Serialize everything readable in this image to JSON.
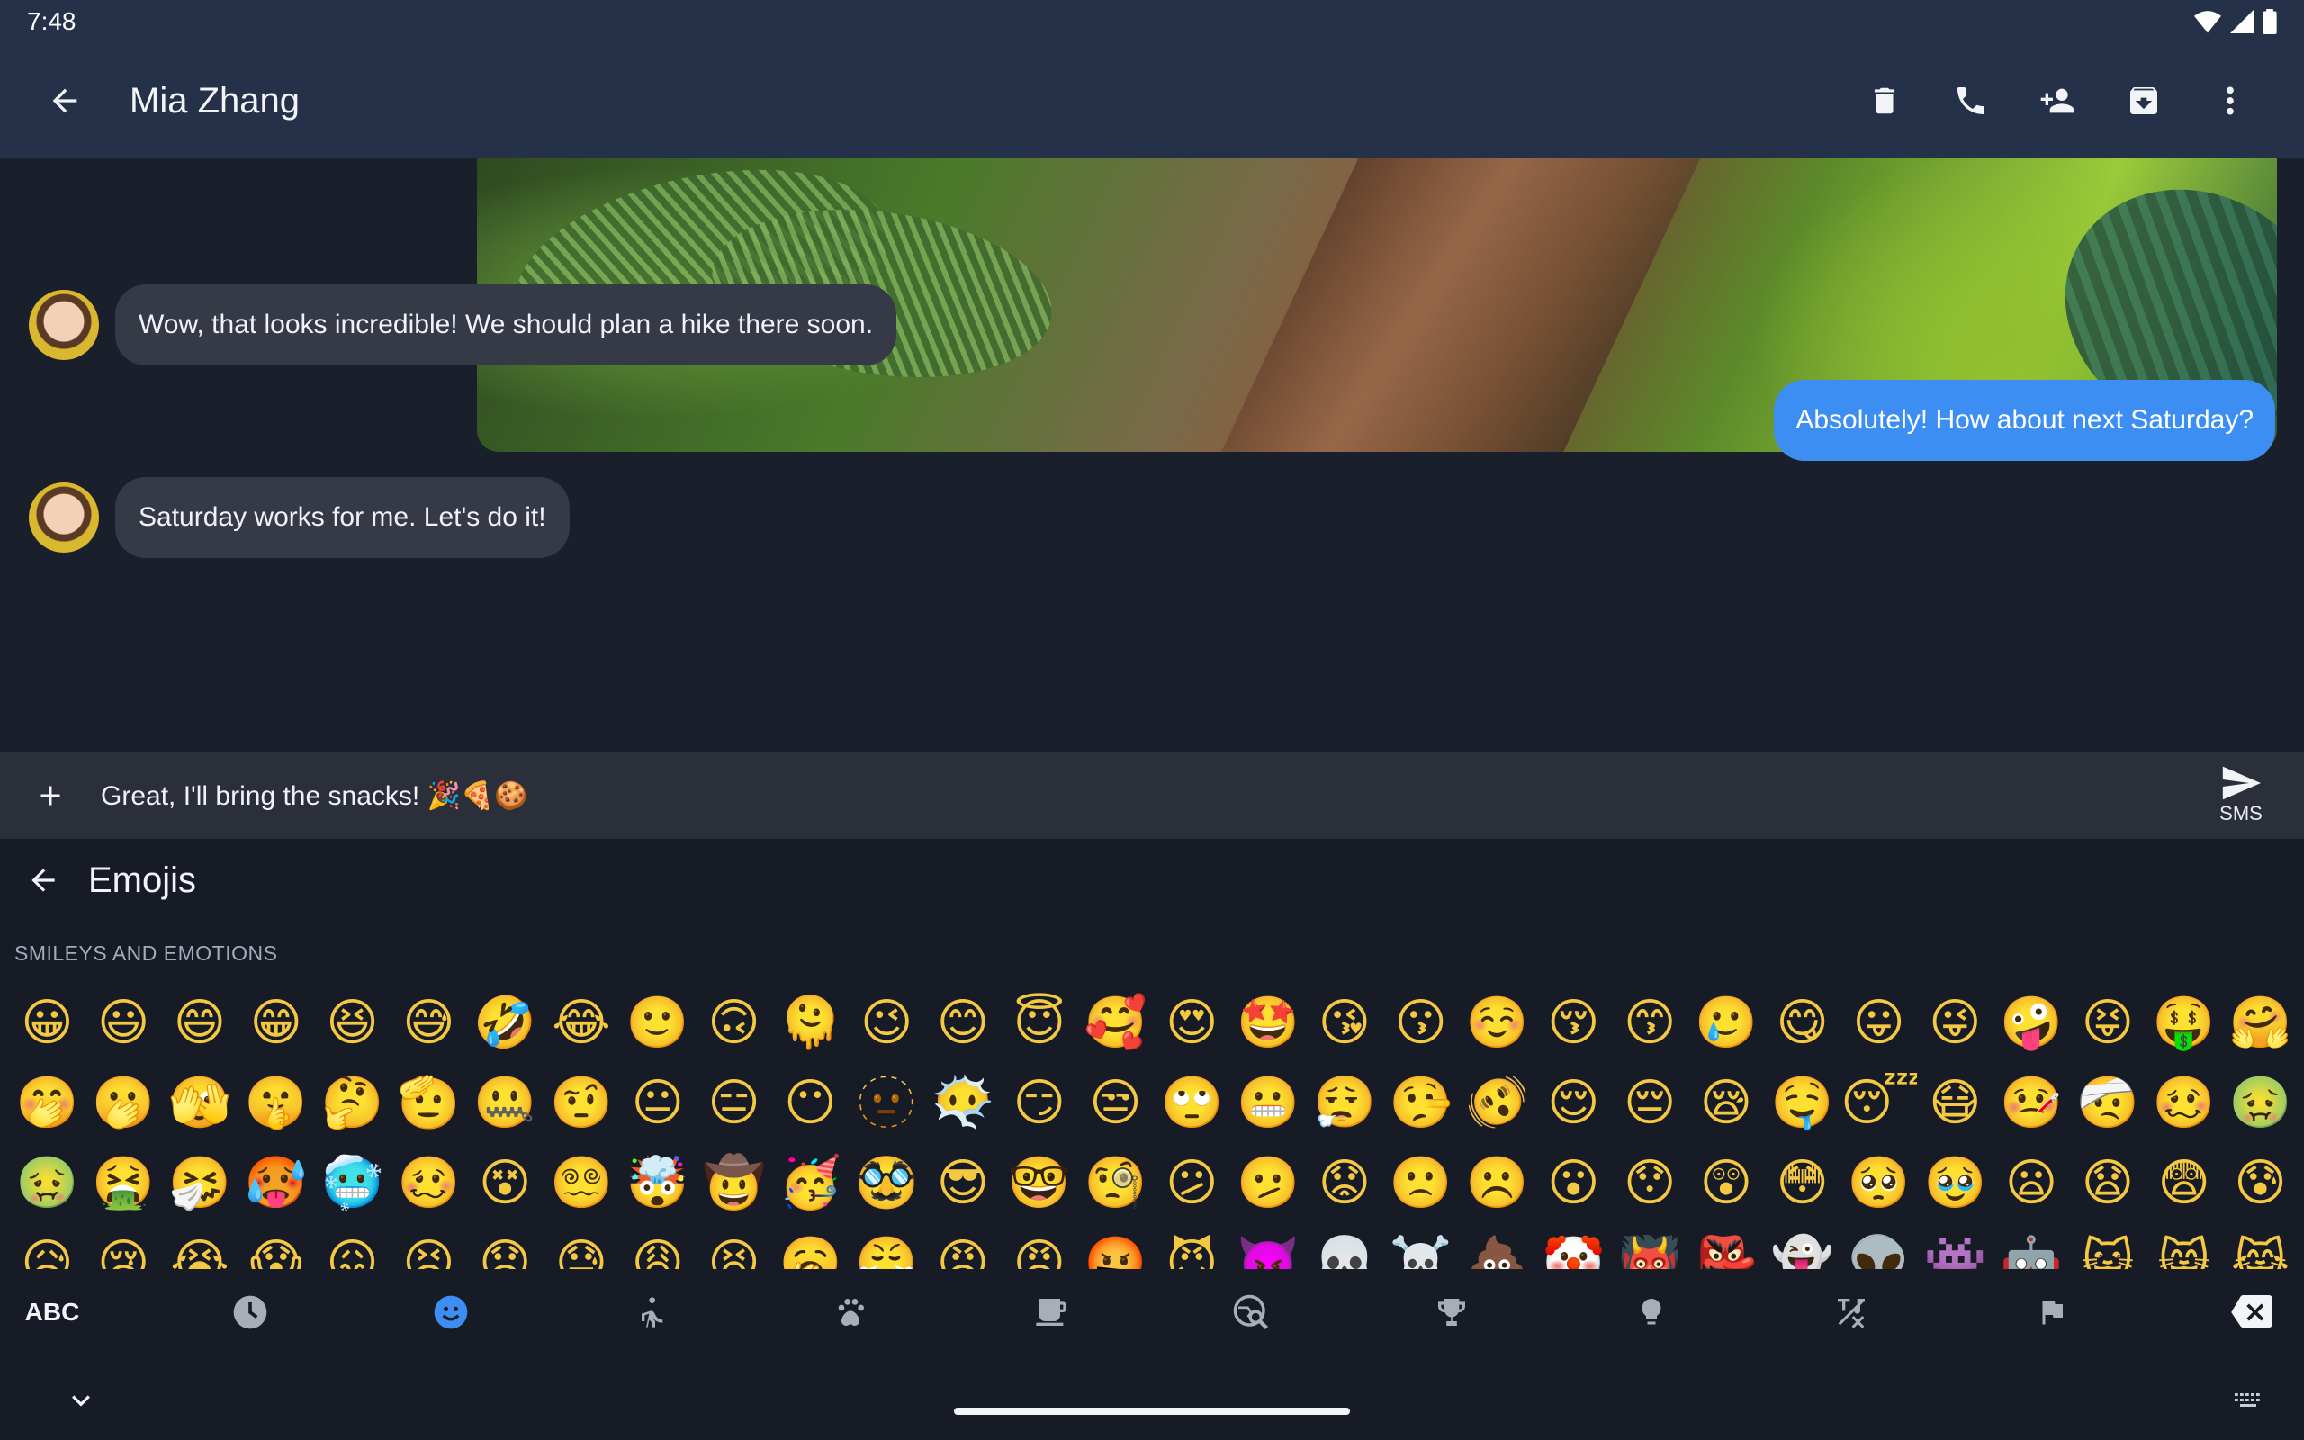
{
  "status": {
    "time": "7:48"
  },
  "header": {
    "contact_name": "Mia Zhang"
  },
  "messages": {
    "m1": "Wow, that looks incredible! We should plan a hike there soon.",
    "m2": "Absolutely! How about next Saturday?",
    "m3": "Saturday works for me. Let's do it!"
  },
  "compose": {
    "text": "Great, I'll bring the snacks! 🎉🍕🍪",
    "send_label": "SMS"
  },
  "emoji_picker": {
    "title": "Emojis",
    "category_label": "SMILEYS AND EMOTIONS",
    "rows": [
      [
        "😀",
        "😃",
        "😄",
        "😁",
        "😆",
        "😅",
        "🤣",
        "😂",
        "🙂",
        "🙃",
        "🫠",
        "😉",
        "😊",
        "😇",
        "🥰",
        "😍",
        "🤩",
        "😘",
        "😗",
        "☺️",
        "😚",
        "😙",
        "🥲",
        "😋",
        "😛",
        "😜",
        "🤪",
        "😝",
        "🤑",
        "🤗"
      ],
      [
        "🤭",
        "🫢",
        "🫣",
        "🤫",
        "🤔",
        "🫡",
        "🤐",
        "🤨",
        "😐",
        "😑",
        "😶",
        "🫥",
        "😶‍🌫️",
        "😏",
        "😒",
        "🙄",
        "😬",
        "😮‍💨",
        "🤥",
        "🫨",
        "😌",
        "😔",
        "😪",
        "🤤",
        "😴",
        "😷",
        "🤒",
        "🤕",
        "🥴",
        "🤢"
      ],
      [
        "🤢",
        "🤮",
        "🤧",
        "🥵",
        "🥶",
        "🥴",
        "😵",
        "😵‍💫",
        "🤯",
        "🤠",
        "🥳",
        "🥸",
        "😎",
        "🤓",
        "🧐",
        "😕",
        "🫤",
        "😟",
        "🙁",
        "☹️",
        "😮",
        "😯",
        "😲",
        "😳",
        "🥺",
        "🥹",
        "😦",
        "😧",
        "😨",
        "😰"
      ],
      [
        "😥",
        "😢",
        "😭",
        "😱",
        "😖",
        "😣",
        "😞",
        "😓",
        "😩",
        "😫",
        "🥱",
        "😤",
        "😡",
        "😠",
        "🤬",
        "😈",
        "👿",
        "💀",
        "☠️",
        "💩",
        "🤡",
        "👹",
        "👺",
        "👻",
        "👽",
        "👾",
        "🤖",
        "😺",
        "😸",
        "😹"
      ]
    ],
    "categories": [
      {
        "name": "abc",
        "label": "ABC"
      },
      {
        "name": "recent"
      },
      {
        "name": "smileys"
      },
      {
        "name": "people"
      },
      {
        "name": "animals"
      },
      {
        "name": "food"
      },
      {
        "name": "travel"
      },
      {
        "name": "activities"
      },
      {
        "name": "objects"
      },
      {
        "name": "symbols"
      },
      {
        "name": "flags"
      },
      {
        "name": "backspace"
      }
    ]
  },
  "colors": {
    "app_bar": "#253049",
    "background": "#1a1f2c",
    "outgoing_bubble": "#3d8ef2",
    "incoming_bubble": "#353a46",
    "selected_category": "#3d8ef2"
  }
}
